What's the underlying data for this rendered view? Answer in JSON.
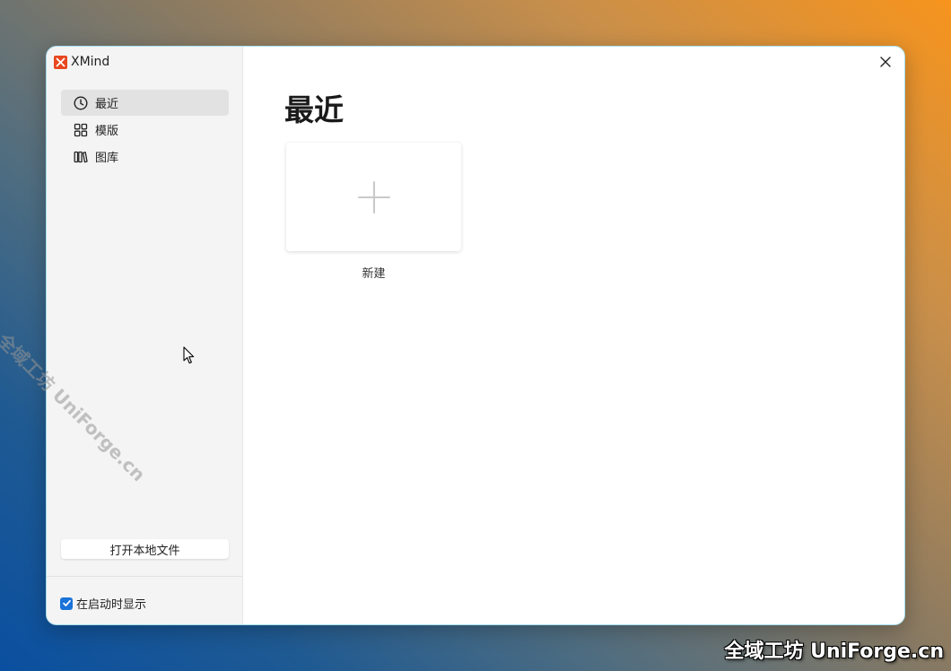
{
  "app": {
    "title": "XMind",
    "logo_icon": "xmind-logo-icon",
    "logo_color": "#e8471f"
  },
  "sidebar": {
    "items": [
      {
        "label": "最近",
        "icon": "clock-icon",
        "active": true
      },
      {
        "label": "模版",
        "icon": "template-grid-icon",
        "active": false
      },
      {
        "label": "图库",
        "icon": "library-books-icon",
        "active": false
      }
    ],
    "open_file_label": "打开本地文件",
    "show_on_startup": {
      "label": "在启动时显示",
      "checked": true
    }
  },
  "main": {
    "title": "最近",
    "new_card": {
      "label": "新建",
      "icon": "plus-icon"
    },
    "close_icon": "close-icon"
  },
  "watermark": {
    "diagonal": "全域工坊 UniForge.cn",
    "corner": "全域工坊 UniForge.cn"
  },
  "colors": {
    "accent": "#1a73d9",
    "sidebar_bg": "#f4f4f4",
    "active_item_bg": "#e2e2e2"
  }
}
